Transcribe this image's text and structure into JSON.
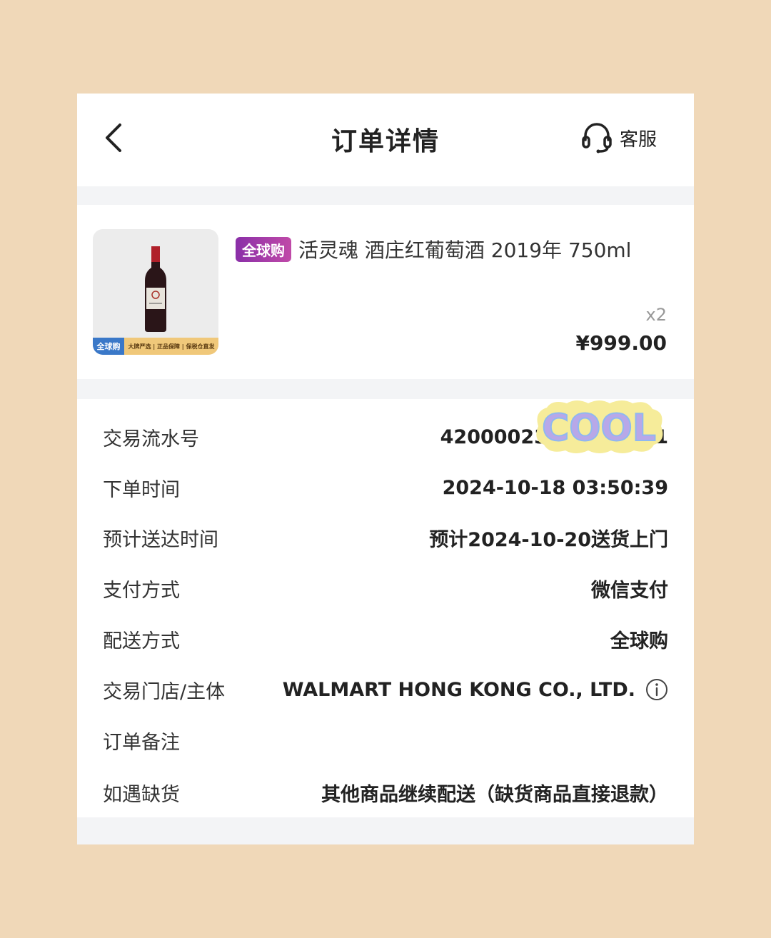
{
  "header": {
    "title": "订单详情",
    "service_label": "客服"
  },
  "product": {
    "tag": "全球购",
    "name": "活灵魂 酒庄红葡萄酒 2019年 750ml",
    "quantity": "x2",
    "price": "¥999.00",
    "thumb_banner_left": "全球购",
    "thumb_banner_right": "大牌严选 | 正品保障 | 保税仓直发"
  },
  "details": [
    {
      "label": "交易流水号",
      "value": "42000023702024101"
    },
    {
      "label": "下单时间",
      "value": "2024-10-18 03:50:39"
    },
    {
      "label": "预计送达时间",
      "value": "预计2024-10-20送货上门"
    },
    {
      "label": "支付方式",
      "value": "微信支付"
    },
    {
      "label": "配送方式",
      "value": "全球购"
    },
    {
      "label": "交易门店/主体",
      "value": "WALMART HONG KONG CO., LTD."
    },
    {
      "label": "订单备注",
      "value": ""
    },
    {
      "label": "如遇缺货",
      "value": "其他商品继续配送（缺货商品直接退款）"
    }
  ],
  "sticker_text": "COOL"
}
